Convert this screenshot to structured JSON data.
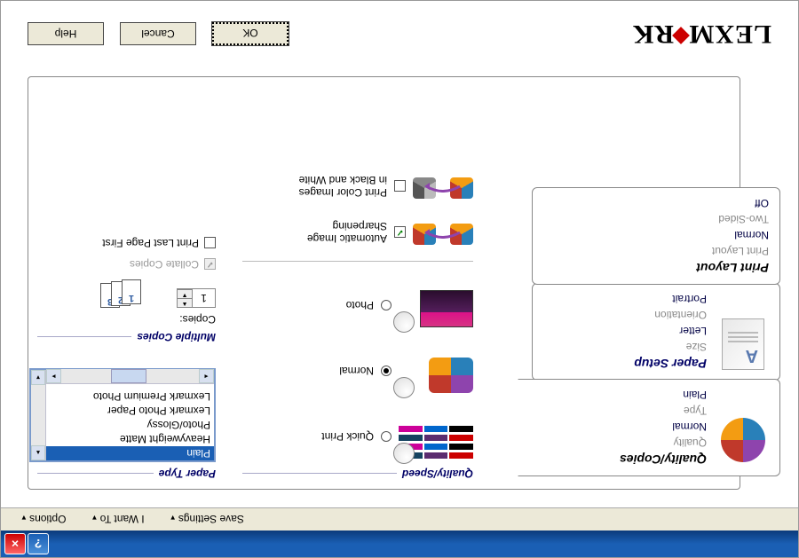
{
  "titlebar": {
    "close_icon": "×",
    "help_icon": "?"
  },
  "menubar": {
    "options": "Options",
    "iwantto": "I Want To",
    "savesettings": "Save Settings"
  },
  "tabs": {
    "quality": {
      "title": "Quality/Copies",
      "quality_label": "Quality",
      "quality_value": "Normal",
      "type_label": "Type",
      "type_value": "Plain"
    },
    "paper": {
      "title": "Paper Setup",
      "size_label": "Size",
      "size_value": "Letter",
      "orient_label": "Orientation",
      "orient_value": "Portrait"
    },
    "layout": {
      "title": "Print Layout",
      "pl_label": "Print Layout",
      "pl_value": "Normal",
      "ts_label": "Two-Sided",
      "ts_value": "Off"
    }
  },
  "quality_speed": {
    "title": "Quality/Speed",
    "quick": "Quick Print",
    "normal": "Normal",
    "photo": "Photo"
  },
  "auto_image": {
    "ai_label": "Automatic Image Sharpening",
    "bw_label_1": "Print Color Images",
    "bw_label_2": "in Black and White"
  },
  "paper_type": {
    "title": "Paper Type",
    "items": [
      "Plain",
      "Heavyweight Matte",
      "Photo/Glossy",
      "Lexmark Photo Paper",
      "Lexmark Premium Photo"
    ]
  },
  "multiple_copies": {
    "title": "Multiple Copies",
    "copies_label": "Copies:",
    "copies_value": "1",
    "collate": "Collate Copies",
    "lastfirst": "Print Last Page First",
    "p1": "1",
    "p2": "2",
    "p3": "3"
  },
  "footer": {
    "ok": "OK",
    "cancel": "Cancel",
    "help": "Help",
    "logo1": "LEXM",
    "logo2": "RK"
  }
}
